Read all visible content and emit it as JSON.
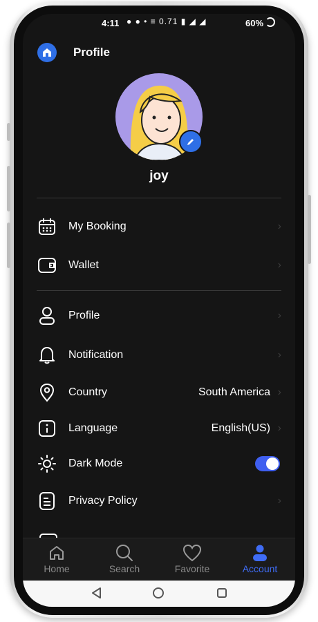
{
  "status_bar": {
    "time": "4:11",
    "icons_text": "● ● • ≡ 0.71 ▮ ◢ ◢",
    "battery": "60%"
  },
  "header": {
    "title": "Profile",
    "icon": "home-icon"
  },
  "profile": {
    "username": "joy",
    "avatar_bg": "#a99ae8"
  },
  "menu_group_1": [
    {
      "label": "My Booking",
      "icon": "calendar-icon"
    },
    {
      "label": "Wallet",
      "icon": "wallet-icon"
    }
  ],
  "menu_group_2": [
    {
      "label": "Profile",
      "icon": "user-icon"
    },
    {
      "label": "Notification",
      "icon": "bell-icon"
    },
    {
      "label": "Country",
      "value": "South America",
      "icon": "location-icon"
    },
    {
      "label": "Language",
      "value": "English(US)",
      "icon": "info-icon"
    },
    {
      "label": "Dark Mode",
      "icon": "sun-icon",
      "toggle_on": true
    },
    {
      "label": "Privacy Policy",
      "icon": "document-icon"
    }
  ],
  "bottom_nav": [
    {
      "label": "Home",
      "icon": "home-outline-icon",
      "active": false
    },
    {
      "label": "Search",
      "icon": "search-icon",
      "active": false
    },
    {
      "label": "Favorite",
      "icon": "heart-icon",
      "active": false
    },
    {
      "label": "Account",
      "icon": "person-icon",
      "active": true
    }
  ],
  "colors": {
    "accent": "#3f6cf5",
    "background": "#151515",
    "text": "#ffffff"
  }
}
